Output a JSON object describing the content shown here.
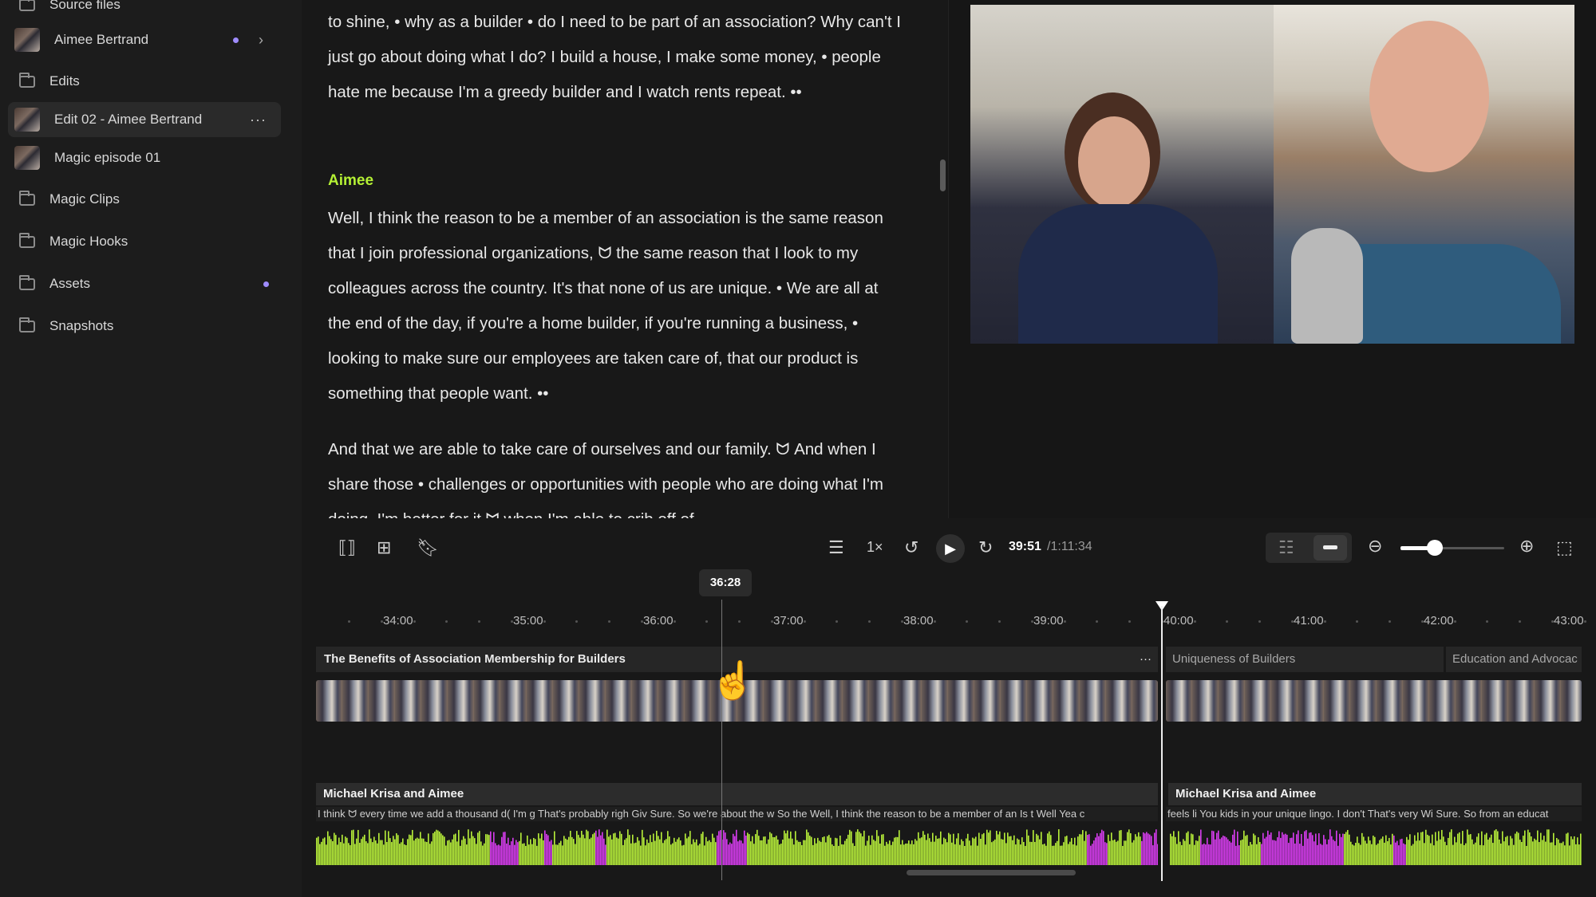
{
  "sidebar": {
    "items": [
      {
        "label": "Source files",
        "type": "folder"
      },
      {
        "label": "Aimee Bertrand",
        "type": "media"
      },
      {
        "label": "Edits",
        "type": "folder"
      },
      {
        "label": "Edit 02 - Aimee Bertrand",
        "type": "media",
        "active": true
      },
      {
        "label": "Magic episode 01",
        "type": "media"
      },
      {
        "label": "Magic Clips",
        "type": "folder"
      },
      {
        "label": "Magic Hooks",
        "type": "folder"
      },
      {
        "label": "Assets",
        "type": "folder"
      },
      {
        "label": "Snapshots",
        "type": "folder"
      }
    ],
    "more_glyph": "···",
    "chevron_glyph": "›"
  },
  "transcript": {
    "para1": "to shine, • why as a builder • do I need to be part of an association? Why can't I just go about doing what I do? I build a house, I make some money, • people hate me because I'm a greedy builder and I watch rents repeat. ••",
    "speaker": "Aimee",
    "para2": "Well, I think the reason to be a member of an association is the same reason that I join professional organizations, ᗢ the same reason that I look to my colleagues across the country. It's that none of us are unique. • We are all at the end of the day, if you're a home builder, if you're running a business, • looking to make sure our employees are taken care of, that our product is something that people want. ••",
    "para3": "And that we are able to take care of ourselves and our family. ᗢ And when I share those • challenges or opportunities with people who are doing what I'm doing, I'm better for it ᗢ when I'm able to crib off of"
  },
  "player": {
    "speed": "1×",
    "current_time": "39:51",
    "total_time": "/1:11:34",
    "zoom_level": 0.25
  },
  "timeline": {
    "hover_time": "36:28",
    "ruler": [
      "34:00",
      "35:00",
      "36:00",
      "37:00",
      "38:00",
      "39:00",
      "40:00",
      "41:00",
      "42:00",
      "43:00"
    ],
    "chapters": [
      "The Benefits of Association Membership for Builders",
      "Uniqueness of Builders",
      "Education and Advocac"
    ],
    "chapter_more": "···",
    "audio_track_label": "Michael Krisa and Aimee",
    "words_a": "I think ᗢ  every time we add a thousand d( I'm g That's probably righ Giv Sure. So we're about the w So the   Well, I think the reason to be a member of an  Is t  Well  Yea c",
    "words_b": "feels li You kids in your unique lingo. I don't That's very Wi Sure. So from an educat"
  },
  "colors": {
    "accent": "#b4f034",
    "wave_green": "#b8f03a",
    "wave_pink": "#d83cf0",
    "dot": "#9f8cff"
  }
}
